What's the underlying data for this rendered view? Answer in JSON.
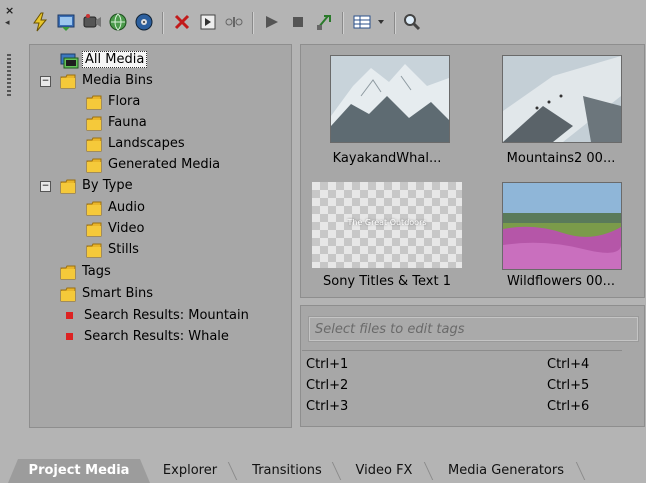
{
  "tree": {
    "all_media": "All Media",
    "media_bins": "Media Bins",
    "bins": [
      "Flora",
      "Fauna",
      "Landscapes",
      "Generated Media"
    ],
    "by_type": "By Type",
    "types": [
      "Audio",
      "Video",
      "Stills"
    ],
    "tags": "Tags",
    "smart_bins": "Smart Bins",
    "searches": [
      "Search Results: Mountain",
      "Search Results: Whale"
    ],
    "expander_symbol": "−"
  },
  "thumbs": [
    {
      "caption": "KayakandWhal..."
    },
    {
      "caption": "Mountains2 00..."
    },
    {
      "caption": "Sony Titles & Text 1",
      "overlay": "The Great Outdoors"
    },
    {
      "caption": "Wildflowers 00..."
    }
  ],
  "tags_panel": {
    "placeholder": "Select files to edit tags",
    "shortcuts_left": [
      "Ctrl+1",
      "Ctrl+2",
      "Ctrl+3"
    ],
    "shortcuts_right": [
      "Ctrl+4",
      "Ctrl+5",
      "Ctrl+6"
    ]
  },
  "tabs": [
    "Project Media",
    "Explorer",
    "Transitions",
    "Video FX",
    "Media Generators"
  ],
  "grip": {
    "close": "×",
    "pin": "◂"
  },
  "colors": {
    "folder": "#e9b52a",
    "red_marker": "#d22222",
    "active_tab": "#9c9c9c"
  }
}
